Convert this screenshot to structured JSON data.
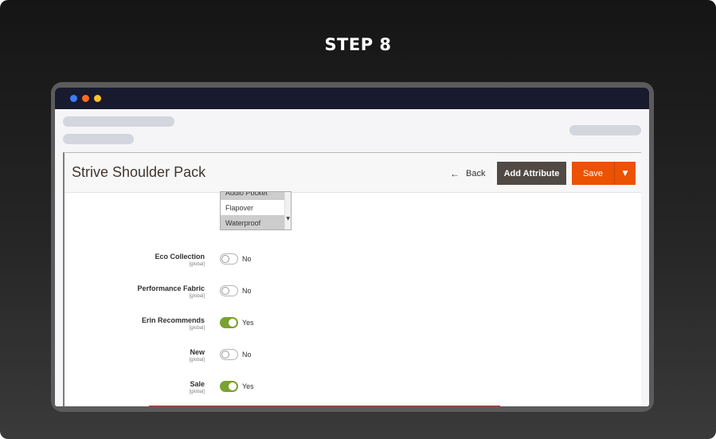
{
  "step_title": "STEP 8",
  "page": {
    "title": "Strive Shoulder Pack",
    "back_label": "Back",
    "add_attribute_label": "Add Attribute",
    "save_label": "Save"
  },
  "multiselect": {
    "options": [
      "Audio Pocket",
      "Flapover",
      "Waterproof"
    ],
    "selected": [
      "Audio Pocket",
      "Waterproof"
    ]
  },
  "fields": [
    {
      "label": "Eco Collection",
      "scope": "[global]",
      "value": "No",
      "on": false
    },
    {
      "label": "Performance Fabric",
      "scope": "[global]",
      "value": "No",
      "on": false
    },
    {
      "label": "Erin Recommends",
      "scope": "[global]",
      "value": "Yes",
      "on": true
    },
    {
      "label": "New",
      "scope": "[global]",
      "value": "No",
      "on": false
    },
    {
      "label": "Sale",
      "scope": "[global]",
      "value": "Yes",
      "on": true
    }
  ],
  "colors": {
    "accent": "#eb5202",
    "dark_button": "#514943",
    "toggle_on": "#79a22e",
    "titlebar": "#181a2e"
  }
}
